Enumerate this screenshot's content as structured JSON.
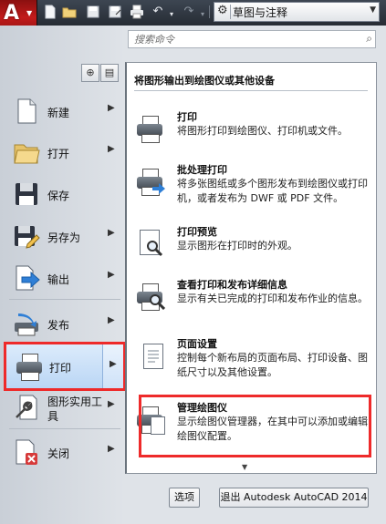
{
  "titlebar": {
    "app_logo": "A",
    "workspace": "草图与注释",
    "qat_icons": [
      "new-icon",
      "open-icon",
      "save-icon",
      "saveas-icon",
      "print-icon",
      "undo-icon",
      "redo-icon"
    ]
  },
  "search": {
    "placeholder": "搜索命令"
  },
  "menu": {
    "items": [
      {
        "label": "新建",
        "icon": "new-doc-icon",
        "arrow": "▶"
      },
      {
        "label": "打开",
        "icon": "folder-open-icon",
        "arrow": "▶"
      },
      {
        "label": "保存",
        "icon": "floppy-save-icon",
        "arrow": ""
      },
      {
        "label": "另存为",
        "icon": "save-as-icon",
        "arrow": "▶"
      },
      {
        "label": "输出",
        "icon": "export-icon",
        "arrow": "▶"
      },
      {
        "label": "发布",
        "icon": "publish-icon",
        "arrow": "▶"
      },
      {
        "label": "打印",
        "icon": "printer-icon",
        "arrow": "▶"
      },
      {
        "label": "图形实用工具",
        "icon": "wrench-icon",
        "arrow": "▶"
      },
      {
        "label": "关闭",
        "icon": "close-doc-icon",
        "arrow": "▶"
      }
    ]
  },
  "submenu": {
    "header": "将图形输出到绘图仪或其他设备",
    "entries": [
      {
        "title": "打印",
        "desc": "将图形打印到绘图仪、打印机或文件。",
        "icon": "printer-icon"
      },
      {
        "title": "批处理打印",
        "desc": "将多张图纸或多个图形发布到绘图仪或打印机，或者发布为 DWF 或 PDF 文件。",
        "icon": "batch-plot-icon"
      },
      {
        "title": "打印预览",
        "desc": "显示图形在打印时的外观。",
        "icon": "plot-preview-icon"
      },
      {
        "title": "查看打印和发布详细信息",
        "desc": "显示有关已完成的打印和发布作业的信息。",
        "icon": "plot-details-icon"
      },
      {
        "title": "页面设置",
        "desc": "控制每个新布局的页面布局、打印设备、图纸尺寸以及其他设置。",
        "icon": "page-setup-icon"
      },
      {
        "title": "管理绘图仪",
        "desc": "显示绘图仪管理器，在其中可以添加或编辑绘图仪配置。",
        "icon": "plotter-manager-icon"
      }
    ]
  },
  "buttons": {
    "options": "选项",
    "exit": "退出 Autodesk AutoCAD 2014"
  },
  "colors": {
    "highlight_border": "#ee2a2a",
    "app_button": "#c21b1b",
    "selected_item": "#bad6f5"
  }
}
